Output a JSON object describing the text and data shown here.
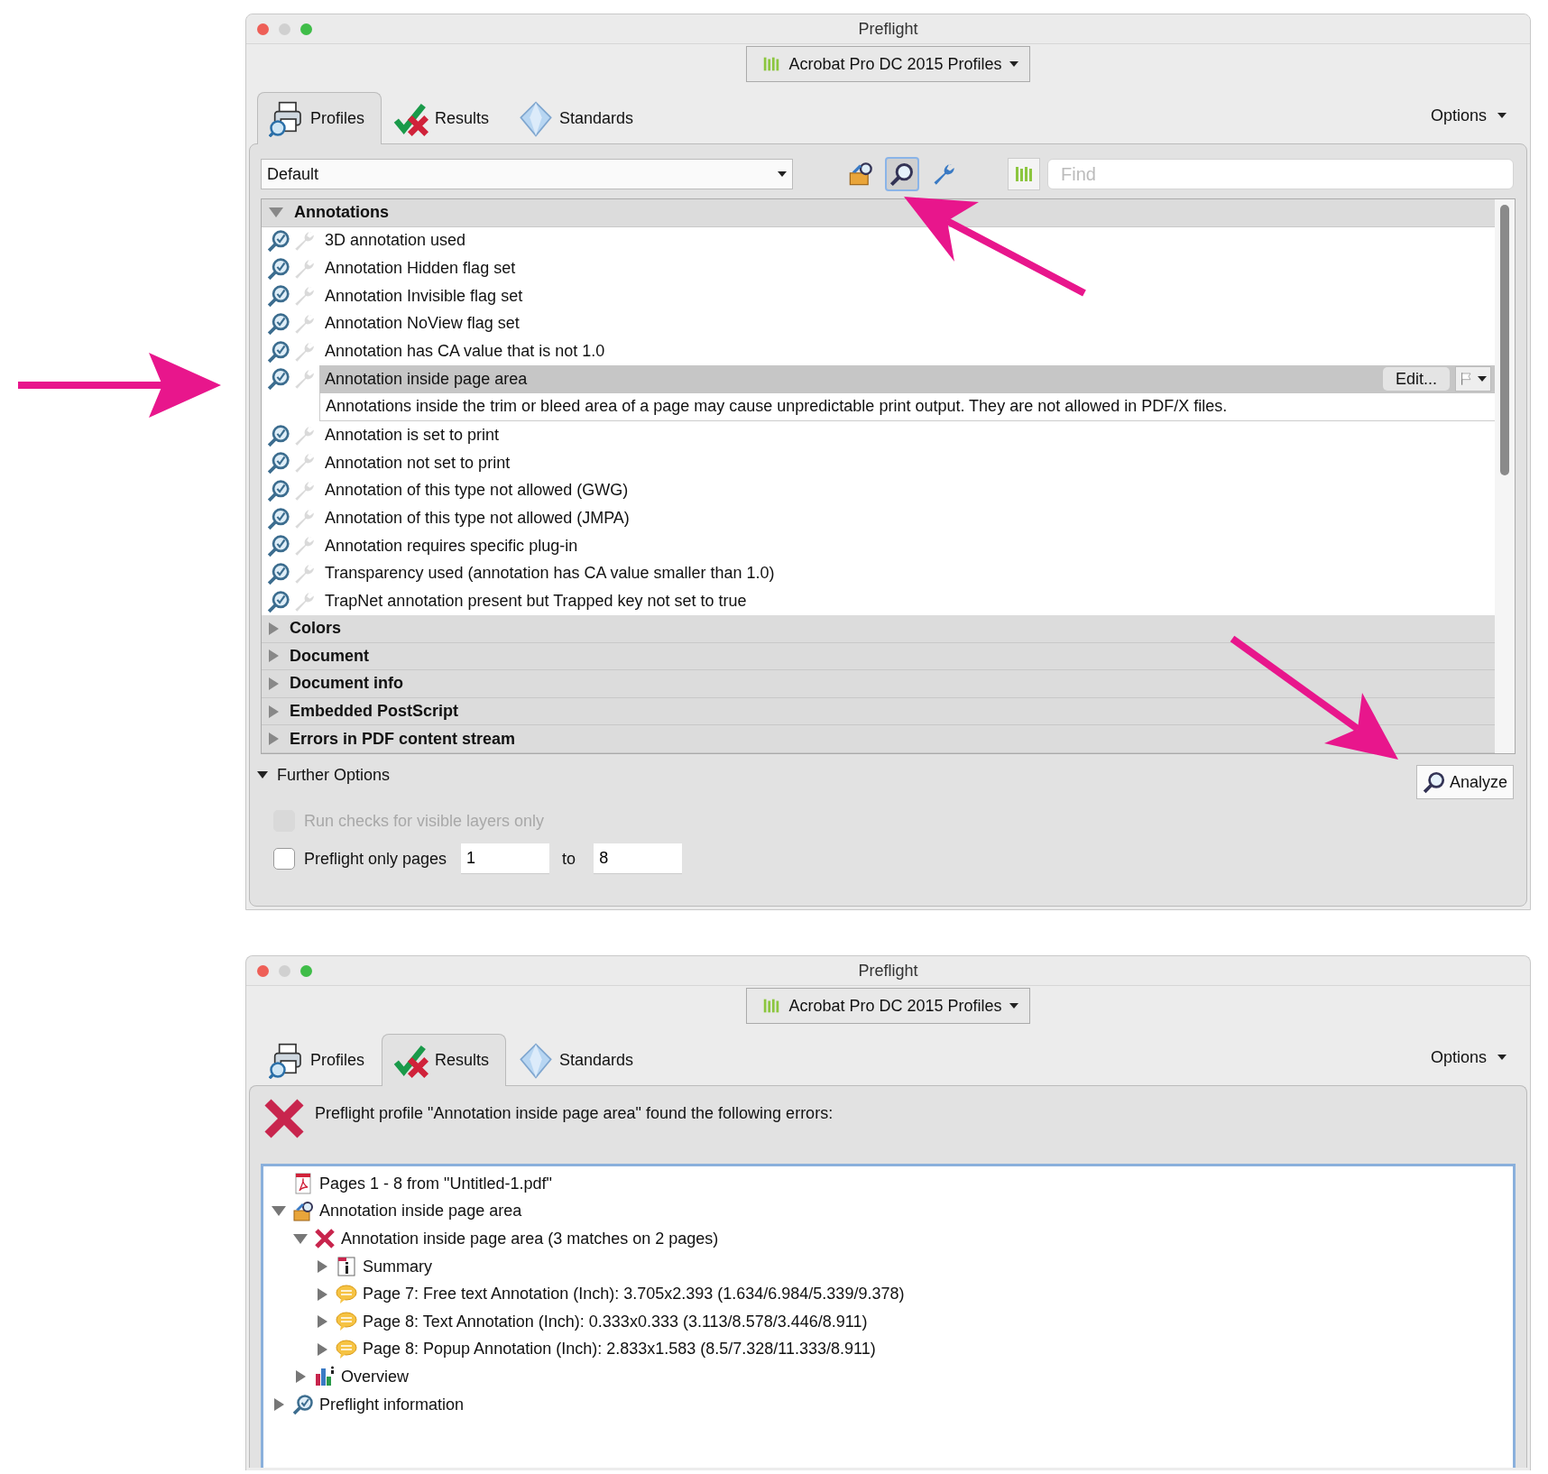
{
  "profiles_window": {
    "title": "Preflight",
    "library_button": {
      "label": "Acrobat Pro DC 2015 Profiles"
    },
    "tabs": [
      {
        "label": "Profiles",
        "kind": "profiles",
        "selected": true
      },
      {
        "label": "Results",
        "kind": "results",
        "selected": false
      },
      {
        "label": "Standards",
        "kind": "standards",
        "selected": false
      }
    ],
    "options_menu": {
      "label": "Options"
    },
    "profile_select": {
      "value": "Default"
    },
    "toolbar_buttons": [
      {
        "kind": "profiles",
        "selected": false
      },
      {
        "kind": "checks",
        "selected": true
      },
      {
        "kind": "fixups",
        "selected": false
      }
    ],
    "search": {
      "placeholder": "Find"
    },
    "groups": [
      {
        "label": "Annotations",
        "expanded": true,
        "items": [
          {
            "label": "3D annotation used",
            "selected": false
          },
          {
            "label": "Annotation Hidden flag set",
            "selected": false
          },
          {
            "label": "Annotation Invisible flag set",
            "selected": false
          },
          {
            "label": "Annotation NoView flag set",
            "selected": false
          },
          {
            "label": "Annotation has CA value that is not 1.0",
            "selected": false
          },
          {
            "label": "Annotation inside page area",
            "selected": true,
            "edit_button": "Edit...",
            "description": "Annotations inside the trim or bleed area of a page may cause unpredictable print output. They are not allowed in PDF/X files."
          },
          {
            "label": "Annotation is set to print",
            "selected": false
          },
          {
            "label": "Annotation not set to print",
            "selected": false
          },
          {
            "label": "Annotation of this type not allowed (GWG)",
            "selected": false
          },
          {
            "label": "Annotation of this type not allowed (JMPA)",
            "selected": false
          },
          {
            "label": "Annotation requires specific plug-in",
            "selected": false
          },
          {
            "label": "Transparency used (annotation has CA value smaller than 1.0)",
            "selected": false
          },
          {
            "label": "TrapNet annotation present but Trapped key not set to true",
            "selected": false
          }
        ]
      },
      {
        "label": "Colors",
        "expanded": false
      },
      {
        "label": "Document",
        "expanded": false
      },
      {
        "label": "Document info",
        "expanded": false
      },
      {
        "label": "Embedded PostScript",
        "expanded": false
      },
      {
        "label": "Errors in PDF content stream",
        "expanded": false
      }
    ],
    "further_options": {
      "label": "Further Options",
      "expanded": true,
      "options": [
        {
          "kind": "checkbox",
          "label": "Run checks for visible layers only",
          "checked": false,
          "disabled": true
        },
        {
          "kind": "page_range",
          "label": "Preflight only pages",
          "checked": false,
          "disabled": false,
          "from": "1",
          "to_label": "to",
          "to": "8"
        }
      ]
    },
    "analyze_button": {
      "label": "Analyze"
    }
  },
  "results_window": {
    "title": "Preflight",
    "library_button": {
      "label": "Acrobat Pro DC 2015 Profiles"
    },
    "tabs": [
      {
        "label": "Profiles",
        "kind": "profiles",
        "selected": false
      },
      {
        "label": "Results",
        "kind": "results",
        "selected": true
      },
      {
        "label": "Standards",
        "kind": "standards",
        "selected": false
      }
    ],
    "options_menu": {
      "label": "Options"
    },
    "message": {
      "text": "Preflight profile \"Annotation inside page area\" found the following errors:"
    },
    "tree": [
      {
        "kind": "pdf",
        "label": "Pages 1 - 8 from \"Untitled-1.pdf\""
      },
      {
        "kind": "profile",
        "label": "Annotation inside page area",
        "expanded": true,
        "children": [
          {
            "kind": "error",
            "label": "Annotation inside page area (3 matches on 2 pages)",
            "expanded": true,
            "children": [
              {
                "kind": "summary",
                "label": "Summary",
                "expanded": false
              },
              {
                "kind": "annotation",
                "label": "Page 7: Free text Annotation (Inch): 3.705x2.393 (1.634/6.984/5.339/9.378)",
                "expanded": false
              },
              {
                "kind": "annotation",
                "label": "Page 8: Text Annotation (Inch): 0.333x0.333 (3.113/8.578/3.446/8.911)",
                "expanded": false
              },
              {
                "kind": "annotation",
                "label": "Page 8: Popup Annotation (Inch): 2.833x1.583 (8.5/7.328/11.333/8.911)",
                "expanded": false
              }
            ]
          },
          {
            "kind": "overview",
            "label": "Overview",
            "expanded": false
          }
        ]
      },
      {
        "kind": "info",
        "label": "Preflight information",
        "expanded": false
      }
    ]
  }
}
